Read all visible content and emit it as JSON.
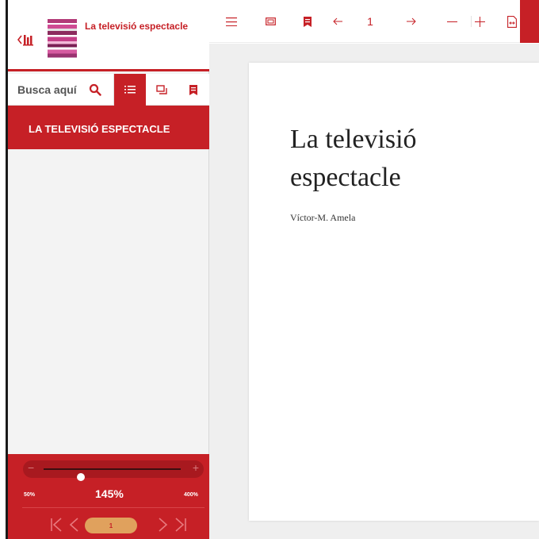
{
  "book": {
    "title": "La televisió espectacle"
  },
  "sidebar": {
    "search_placeholder": "Busca aquí",
    "toc_title": "LA TELEVISIÓ ESPECTACLE"
  },
  "zoom": {
    "min_label": "50%",
    "value_label": "145%",
    "max_label": "400%",
    "min": 50,
    "max": 400,
    "value": 145
  },
  "pagination": {
    "current_page": "1"
  },
  "toolbar": {
    "page_number": "1"
  },
  "document": {
    "title": "La televisió espectacle",
    "author": "Víctor-M. Amela"
  },
  "colors": {
    "accent": "#c62026",
    "page_pill": "#e0a15d",
    "reader_bg": "#efefef"
  },
  "icons": [
    "back-library-icon",
    "search-icon",
    "toc-list-icon",
    "thumbnails-icon",
    "bookmark-icon",
    "menu-icon",
    "fit-page-icon",
    "arrow-left-icon",
    "arrow-right-icon",
    "zoom-out-icon",
    "zoom-in-icon",
    "fit-width-icon",
    "first-page-icon",
    "previous-page-icon",
    "next-page-icon",
    "last-page-icon"
  ]
}
